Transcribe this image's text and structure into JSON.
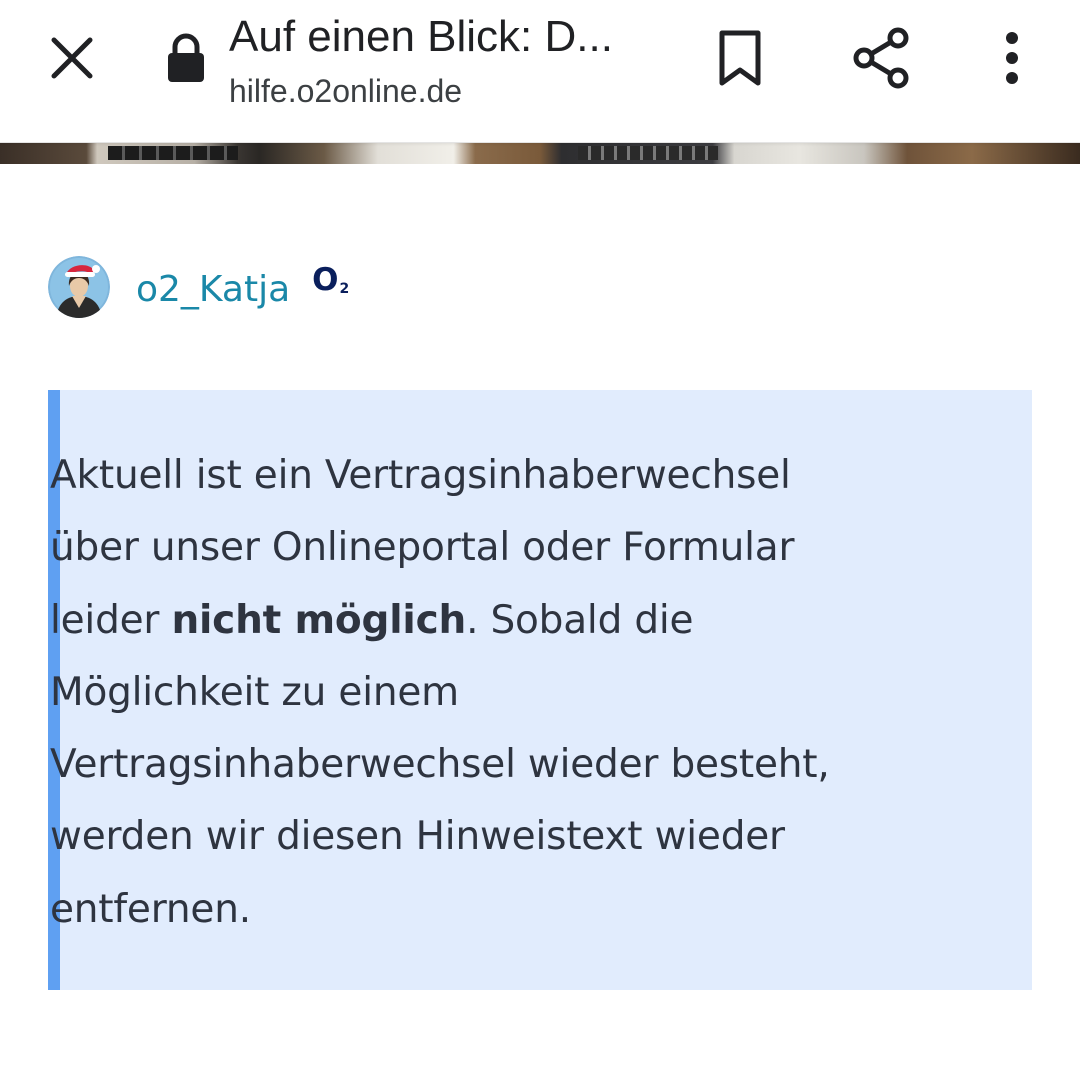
{
  "browser_toolbar": {
    "close_icon": "close-icon",
    "lock_icon": "lock-icon",
    "page_title": "Auf einen Blick: D...",
    "page_url": "hilfe.o2online.de",
    "bookmark_icon": "bookmark-icon",
    "share_icon": "share-icon",
    "menu_icon": "more-vertical-icon"
  },
  "author": {
    "name": "o2_Katja",
    "badge_letter": "O",
    "badge_sub": "2",
    "name_color": "#1a88a8",
    "badge_color": "#0a1f5c"
  },
  "notice": {
    "background": "#e1ecfd",
    "accent": "#5fa0f2",
    "text_lines": [
      "Aktuell ist ein Vertragsinhaberwechsel",
      "über unser Onlineportal oder Formular"
    ],
    "line3_prefix": "leider ",
    "line3_bold": "nicht möglich",
    "line3_suffix": ". Sobald die",
    "text_lines_after": [
      "Möglichkeit zu einem",
      "Vertragsinhaberwechsel wieder besteht,",
      "werden wir diesen Hinweistext wieder",
      "entfernen."
    ]
  }
}
